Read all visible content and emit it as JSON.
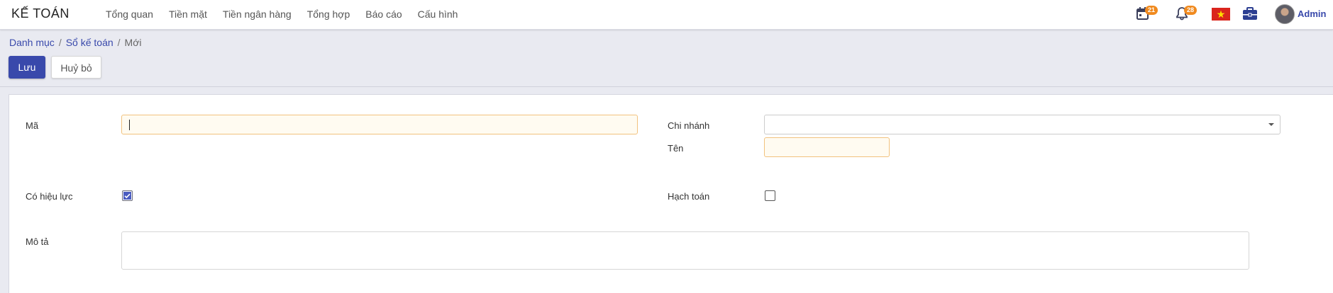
{
  "app": {
    "title": "KẾ TOÁN"
  },
  "menu": [
    {
      "label": "Tổng quan"
    },
    {
      "label": "Tiền mặt"
    },
    {
      "label": "Tiền ngân hàng"
    },
    {
      "label": "Tổng hợp"
    },
    {
      "label": "Báo cáo"
    },
    {
      "label": "Cấu hình"
    }
  ],
  "topbar": {
    "calendar_badge": "21",
    "notification_badge": "28",
    "user_name": "Admin"
  },
  "breadcrumb": {
    "level1": "Danh mục",
    "level2": "Sổ kế toán",
    "current": "Mới",
    "separator": "/"
  },
  "actions": {
    "save_label": "Lưu",
    "cancel_label": "Huỷ bỏ"
  },
  "form": {
    "code_label": "Mã",
    "code_value": "",
    "branch_label": "Chi nhánh",
    "branch_value": "",
    "name_label": "Tên",
    "name_value": "",
    "active_label": "Có hiệu lực",
    "active_checked": true,
    "accounting_label": "Hạch toán",
    "accounting_checked": false,
    "description_label": "Mô tả",
    "description_value": ""
  },
  "colors": {
    "brand": "#3949ab",
    "badge": "#f08a1f",
    "required_field_border": "#f2c27e",
    "required_field_bg": "#fffbf1"
  }
}
